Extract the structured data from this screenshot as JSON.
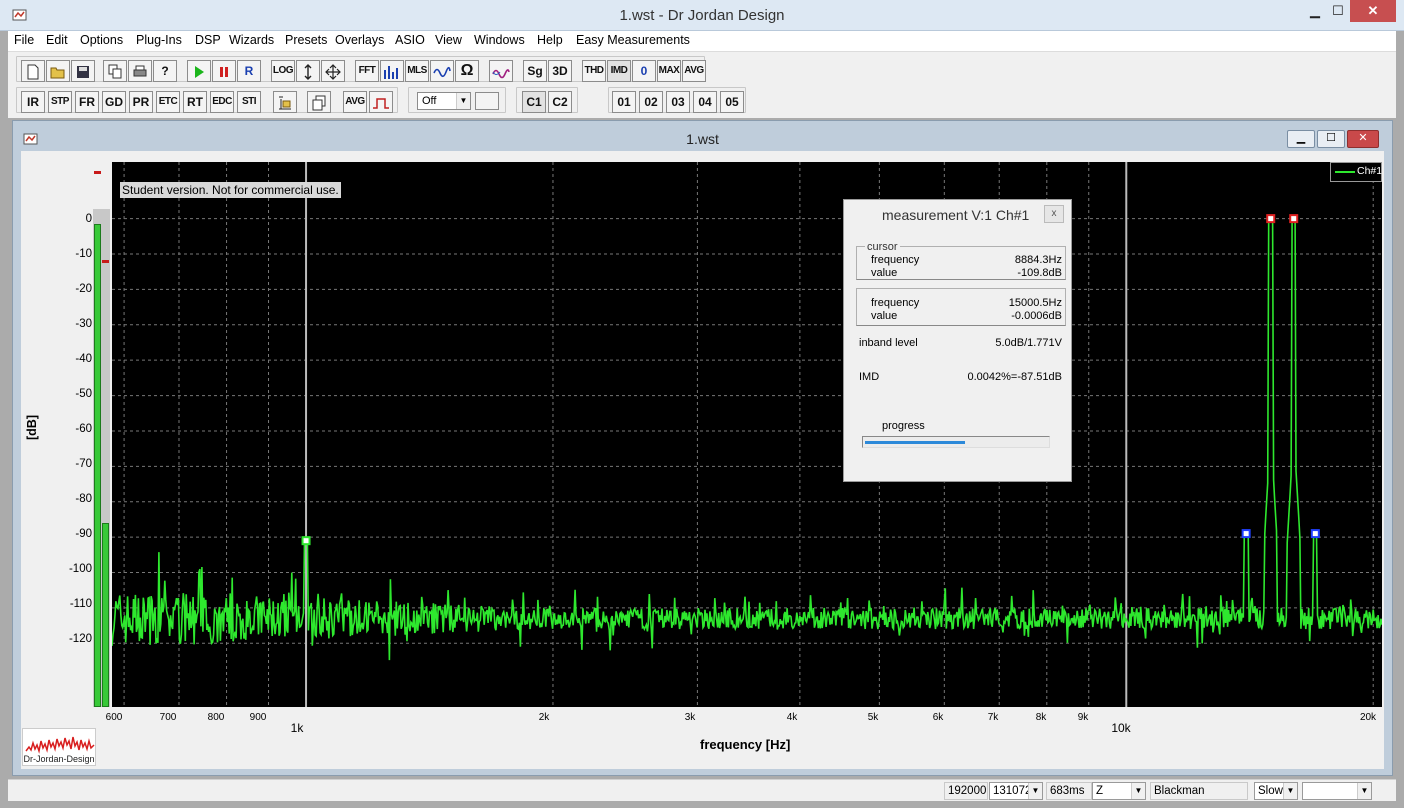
{
  "window": {
    "title": "1.wst - Dr Jordan Design",
    "min": "▁",
    "max": "☐",
    "close": "✕"
  },
  "menu": [
    "File",
    "Edit",
    "Options",
    "Plug-Ins",
    "DSP",
    "Wizards",
    "Presets",
    "Overlays",
    "ASIO",
    "View",
    "Windows",
    "Help",
    "Easy Measurements"
  ],
  "toolbar1": {
    "new": "new-icon",
    "open": "open-icon",
    "save": "save-icon",
    "copy": "copy-icon",
    "print": "print-icon",
    "help": "?",
    "play": "play-icon",
    "pause": "pause-icon",
    "record": "R",
    "log": "LOG",
    "scale": "scale-icon",
    "move": "move-icon",
    "fft": "FFT",
    "spectrum": "spectrum-icon",
    "mls": "MLS",
    "sweep": "sweep-icon",
    "ohm": "Ω",
    "wave": "wave-icon",
    "sg": "Sg",
    "three_d": "3D",
    "thd": "THD",
    "imd": "IMD",
    "zero": "0",
    "max": "MAX",
    "avg": "AVG"
  },
  "toolbar2": {
    "buttons": [
      "IR",
      "STP",
      "FR",
      "GD",
      "PR",
      "ETC",
      "RT",
      "EDC",
      "STI"
    ],
    "avg": "AVG",
    "off_select": "Off",
    "channels": [
      "C1",
      "C2"
    ],
    "presets": [
      "01",
      "02",
      "03",
      "04",
      "05"
    ]
  },
  "child": {
    "title": "1.wst"
  },
  "plot": {
    "notice": "Student version. Not for commercial use.",
    "legend": "Ch#1",
    "series_color": "#2ee82e",
    "y_axis_label": "[dB]",
    "y_ticks": [
      "0",
      "-10",
      "-20",
      "-30",
      "-40",
      "-50",
      "-60",
      "-70",
      "-80",
      "-90",
      "-100",
      "-110",
      "-120"
    ],
    "x_minor_ticks": [
      "600",
      "700",
      "800",
      "900",
      "2k",
      "3k",
      "4k",
      "5k",
      "6k",
      "7k",
      "8k",
      "9k",
      "20k"
    ],
    "x_major_ticks": [
      "1k",
      "10k"
    ],
    "x_axis_label": "frequency [Hz]"
  },
  "chart_data": {
    "type": "line",
    "xlabel": "frequency [Hz]",
    "ylabel": "[dB]",
    "xscale": "log",
    "xlim": [
      580,
      20500
    ],
    "ylim": [
      -138,
      16
    ],
    "grid": true,
    "legend_position": "top-right",
    "series": [
      {
        "name": "Ch#1",
        "color": "#2ee82e"
      }
    ],
    "noise_floor_db": -111,
    "peaks": [
      {
        "x": 1000,
        "y": -91
      },
      {
        "x": 14000,
        "y": -89
      },
      {
        "x": 15000,
        "y": 0
      },
      {
        "x": 16000,
        "y": 0
      },
      {
        "x": 17000,
        "y": -89
      }
    ]
  },
  "meter": {
    "level1": 0.97,
    "level2": 0.37
  },
  "logo_text": "Dr-Jordan-Design",
  "measurement": {
    "title": "measurement V:1 Ch#1",
    "close": "x",
    "cursor_caption": "cursor",
    "cursor_frequency_label": "frequency",
    "cursor_frequency": "8884.3Hz",
    "cursor_value_label": "value",
    "cursor_value": "-109.8dB",
    "peak_frequency_label": "frequency",
    "peak_frequency": "15000.5Hz",
    "peak_value_label": "value",
    "peak_value": "-0.0006dB",
    "inband_label": "inband level",
    "inband_value": "5.0dB/1.771V",
    "imd_label": "IMD",
    "imd_value": "0.0042%=-87.51dB",
    "progress_label": "progress",
    "progress": 0.55
  },
  "status": {
    "rate": "192000",
    "fft_size": "131072",
    "duration": "683ms",
    "weighting": "Z",
    "window": "Blackman",
    "speed": "Slow",
    "extra": ""
  }
}
